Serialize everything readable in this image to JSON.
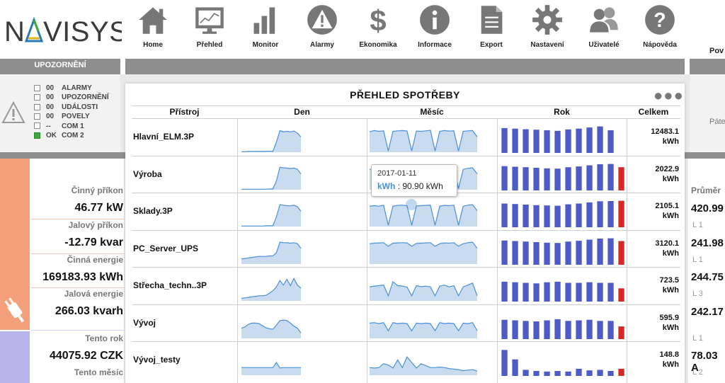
{
  "brand": {
    "logo_text": "NAVISYS",
    "logo_accent_colors": [
      "#2a7ab8",
      "#e7b416",
      "#3cab3c"
    ]
  },
  "nav": [
    {
      "label": "Home",
      "icon": "home-icon"
    },
    {
      "label": "Přehled",
      "icon": "monitor-screen-icon"
    },
    {
      "label": "Monitor",
      "icon": "bar-chart-icon"
    },
    {
      "label": "Alarmy",
      "icon": "warning-icon"
    },
    {
      "label": "Ekonomika",
      "icon": "dollar-icon"
    },
    {
      "label": "Informace",
      "icon": "info-icon"
    },
    {
      "label": "Export",
      "icon": "document-icon"
    },
    {
      "label": "Nastavení",
      "icon": "gear-icon"
    },
    {
      "label": "Uživatelé",
      "icon": "users-icon"
    },
    {
      "label": "Nápověda",
      "icon": "help-icon"
    }
  ],
  "right_header_fragment": "Pov",
  "alerts": {
    "title": "UPOZORNĚNÍ",
    "rows": [
      {
        "value": "00",
        "label": "ALARMY",
        "status": "off"
      },
      {
        "value": "00",
        "label": "UPOZORNĚNÍ",
        "status": "off"
      },
      {
        "value": "00",
        "label": "UDÁLOSTI",
        "status": "off"
      },
      {
        "value": "00",
        "label": "POVELY",
        "status": "off"
      },
      {
        "value": "--",
        "label": "COM 1",
        "status": "off"
      },
      {
        "value": "OK",
        "label": "COM 2",
        "status": "ok"
      }
    ]
  },
  "measurements": [
    {
      "label": "Činný příkon",
      "value": "46.77 kW"
    },
    {
      "label": "Jalový příkon",
      "value": "-12.79 kvar"
    },
    {
      "label": "Činná energie",
      "value": "169183.93 kWh"
    },
    {
      "label": "Jalová energie",
      "value": "266.03 kvarh"
    },
    {
      "label": "Tento rok",
      "value": "44075.92 CZK"
    },
    {
      "label": "Tento měsíc",
      "value": ""
    }
  ],
  "right_fragment": {
    "top_text": "Páte",
    "header": "Průměr",
    "values": [
      "420.99",
      "241.98",
      "244.75",
      "242.17",
      "78.03 A"
    ],
    "subs": [
      "L 1",
      "L 1",
      "L 3",
      "L 1",
      "L 2"
    ]
  },
  "modal": {
    "title": "PŘEHLED SPOTŘEBY",
    "menu_icon": "more-dots-icon",
    "columns": [
      "Přístroj",
      "Den",
      "Měsíc",
      "Rok",
      "Celkem"
    ],
    "bar_color": "#4e5bc6",
    "bar_highlight_color": "#d72828",
    "area_fill": "#c9dcef",
    "area_stroke": "#4a90d9",
    "rows": [
      {
        "device": "Hlavní_ELM.3P",
        "total": "12483.1",
        "unit": "kWh",
        "day": [
          2,
          2,
          3,
          3,
          3,
          3,
          3,
          3,
          4,
          4,
          40,
          85,
          80,
          82,
          80,
          83,
          75,
          60
        ],
        "month": [
          80,
          85,
          82,
          84,
          5,
          82,
          84,
          85,
          83,
          5,
          83,
          82,
          84,
          86,
          5,
          82,
          85,
          83,
          84,
          5,
          82,
          84,
          85,
          60
        ],
        "year": [
          90,
          88,
          86,
          84,
          82,
          80,
          85,
          88,
          92,
          96,
          82,
          0
        ],
        "year_highlight": -1
      },
      {
        "device": "Výroba",
        "total": "2022.9",
        "unit": "kWh",
        "day": [
          2,
          2,
          2,
          2,
          2,
          2,
          2,
          2,
          3,
          3,
          35,
          88,
          86,
          85,
          83,
          85,
          80,
          62
        ],
        "month": [
          80,
          82,
          80,
          84,
          5,
          80,
          83,
          84,
          82,
          5,
          81,
          82,
          83,
          84,
          5,
          80,
          83,
          82,
          84,
          5,
          80,
          84,
          86,
          62
        ],
        "year": [
          88,
          86,
          84,
          82,
          80,
          79,
          84,
          87,
          91,
          95,
          96,
          84
        ],
        "year_highlight": 11
      },
      {
        "device": "Sklady.3P",
        "total": "2105.1",
        "unit": "kWh",
        "day": [
          2,
          2,
          2,
          2,
          2,
          2,
          2,
          3,
          3,
          3,
          38,
          86,
          84,
          82,
          81,
          84,
          78,
          60
        ],
        "month": [
          80,
          82,
          80,
          84,
          5,
          80,
          83,
          84,
          82,
          5,
          81,
          82,
          83,
          84,
          5,
          80,
          83,
          82,
          84,
          5,
          80,
          84,
          86,
          62
        ],
        "year": [
          86,
          84,
          82,
          80,
          79,
          78,
          83,
          86,
          90,
          94,
          95,
          96
        ],
        "year_highlight": 11
      },
      {
        "device": "PC_Server_UPS",
        "total": "3120.1",
        "unit": "kWh",
        "day": [
          20,
          22,
          24,
          26,
          28,
          30,
          30,
          30,
          32,
          32,
          45,
          86,
          84,
          84,
          82,
          84,
          80,
          62
        ],
        "month": [
          80,
          82,
          83,
          84,
          70,
          82,
          83,
          84,
          83,
          70,
          81,
          82,
          83,
          84,
          70,
          80,
          83,
          82,
          84,
          70,
          80,
          84,
          86,
          62
        ],
        "year": [
          88,
          86,
          84,
          82,
          80,
          79,
          84,
          87,
          91,
          95,
          96,
          86
        ],
        "year_highlight": 11
      },
      {
        "device": "Střecha_techn..3P",
        "total": "723.5",
        "unit": "kWh",
        "day": [
          10,
          12,
          14,
          16,
          18,
          20,
          20,
          22,
          30,
          40,
          55,
          80,
          62,
          85,
          60,
          88,
          62,
          50
        ],
        "month": [
          55,
          58,
          60,
          62,
          20,
          75,
          60,
          58,
          54,
          20,
          60,
          56,
          58,
          55,
          20,
          58,
          62,
          55,
          60,
          20,
          55,
          62,
          70,
          20
        ],
        "year": [
          72,
          70,
          68,
          66,
          70,
          72,
          68,
          68,
          70,
          68,
          68,
          48
        ],
        "year_highlight": 11
      },
      {
        "device": "Vývoj",
        "total": "595.9",
        "unit": "kWh",
        "day": [
          40,
          45,
          55,
          60,
          60,
          58,
          50,
          42,
          38,
          36,
          52,
          70,
          72,
          70,
          60,
          48,
          40,
          22
        ],
        "month": [
          60,
          62,
          58,
          62,
          30,
          62,
          58,
          60,
          58,
          30,
          60,
          58,
          60,
          58,
          30,
          62,
          58,
          60,
          58,
          30,
          60,
          58,
          62,
          30
        ],
        "year": [
          70,
          68,
          66,
          64,
          68,
          72,
          66,
          68,
          70,
          66,
          66,
          46
        ],
        "year_highlight": 11
      },
      {
        "device": "Vývoj_testy",
        "total": "148.8",
        "unit": "kWh",
        "day": [
          30,
          30,
          30,
          30,
          30,
          30,
          30,
          30,
          30,
          30,
          50,
          28,
          30,
          30,
          30,
          30,
          30,
          30
        ],
        "month": [
          30,
          28,
          30,
          45,
          40,
          28,
          60,
          30,
          72,
          50,
          28,
          45,
          38,
          30,
          30,
          32,
          30,
          26,
          24,
          22,
          18,
          20,
          22,
          16
        ],
        "year": [
          94,
          60,
          22,
          18,
          16,
          18,
          16,
          26,
          20,
          22,
          18,
          26
        ],
        "year_highlight": 11
      }
    ],
    "tooltip": {
      "date": "2017-01-11",
      "series": "kWh",
      "separator": ":",
      "value": "90.90 kWh"
    }
  }
}
